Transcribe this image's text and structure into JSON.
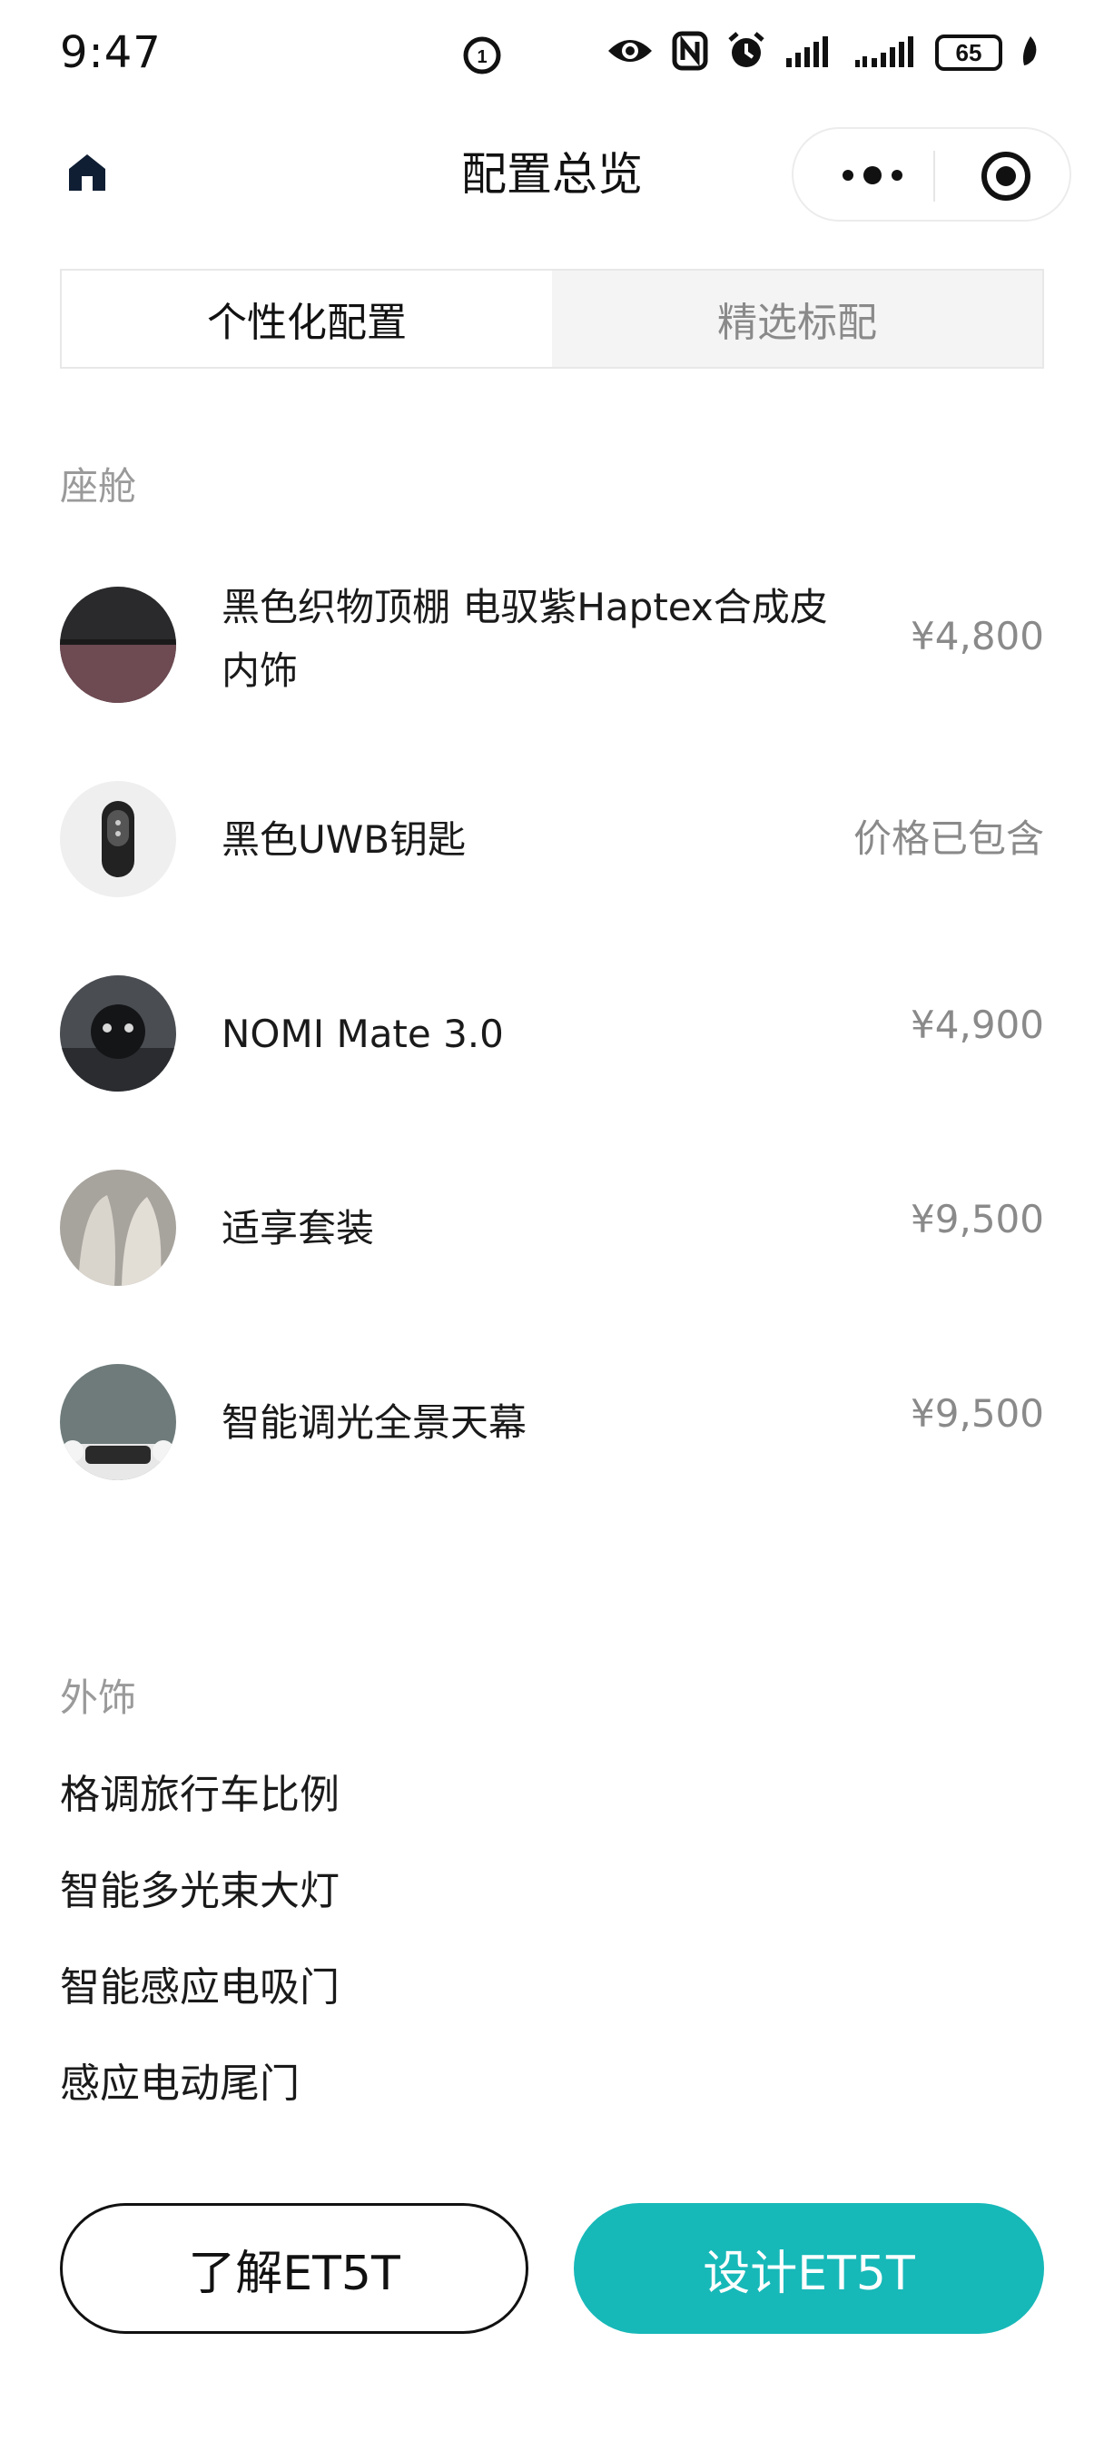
{
  "status_bar": {
    "time": "9:47",
    "battery_level": "65",
    "icons": [
      "eye-comfort-icon",
      "nfc-icon",
      "alarm-icon",
      "signal-icon",
      "signal-icon",
      "battery-icon",
      "leaf-icon"
    ]
  },
  "nav": {
    "title": "配置总览",
    "home_icon": "home-icon",
    "more_icon": "more-dots-icon",
    "close_icon": "target-icon"
  },
  "tabs": [
    {
      "label": "个性化配置",
      "active": true
    },
    {
      "label": "精选标配",
      "active": false
    }
  ],
  "cabin": {
    "label": "座舱",
    "items": [
      {
        "name_line1": "黑色织物顶棚 电驭紫Haptex合成皮",
        "name_line2": "内饰",
        "price": "¥4,800"
      },
      {
        "name": "黑色UWB钥匙",
        "price": "价格已包含"
      },
      {
        "name": "NOMI Mate 3.0",
        "price": "¥4,900"
      },
      {
        "name": "适享套装",
        "price": "¥9,500"
      },
      {
        "name": "智能调光全景天幕",
        "price": "¥9,500"
      }
    ]
  },
  "exterior": {
    "label": "外饰",
    "items": [
      "格调旅行车比例",
      "智能多光束大灯",
      "智能感应电吸门",
      "感应电动尾门"
    ]
  },
  "buttons": {
    "learn": "了解ET5T",
    "design": "设计ET5T"
  },
  "colors": {
    "accent": "#17b8b8",
    "price_gray": "#8a8a8a"
  }
}
